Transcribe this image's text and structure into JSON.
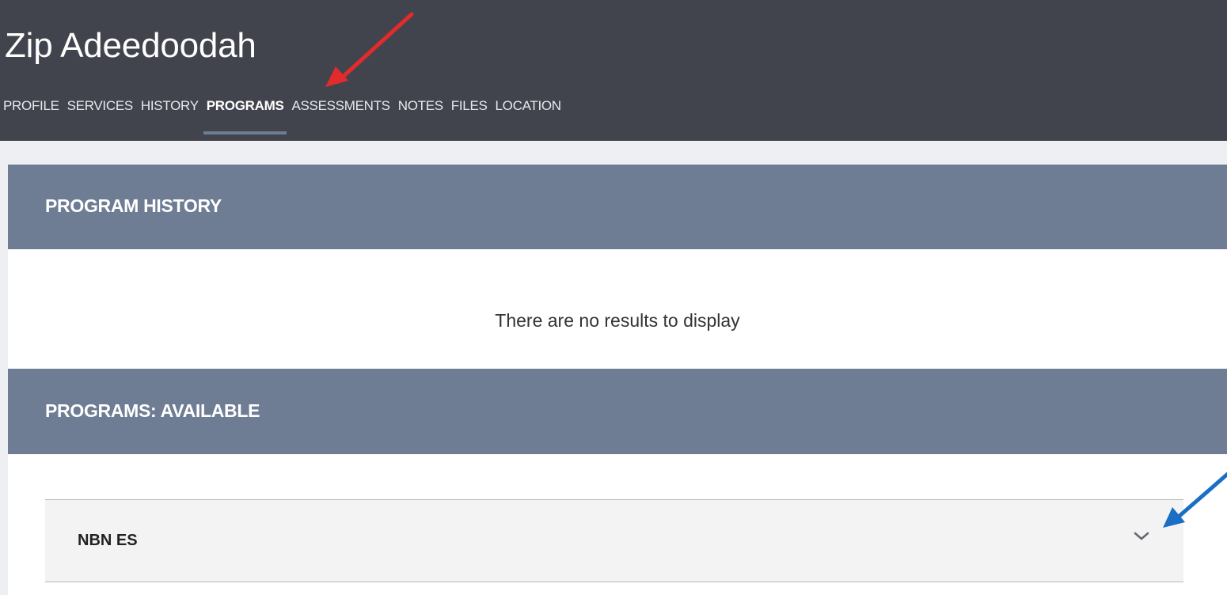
{
  "header": {
    "title": "Zip Adeedoodah",
    "tabs": [
      {
        "label": "PROFILE",
        "active": false
      },
      {
        "label": "SERVICES",
        "active": false
      },
      {
        "label": "HISTORY",
        "active": false
      },
      {
        "label": "PROGRAMS",
        "active": true
      },
      {
        "label": "ASSESSMENTS",
        "active": false
      },
      {
        "label": "NOTES",
        "active": false
      },
      {
        "label": "FILES",
        "active": false
      },
      {
        "label": "LOCATION",
        "active": false
      }
    ]
  },
  "program_history": {
    "title": "PROGRAM HISTORY",
    "empty_message": "There are no results to display"
  },
  "programs_available": {
    "title": "PROGRAMS: AVAILABLE",
    "items": [
      {
        "label": "NBN ES",
        "icon": "chevron-down-icon",
        "expanded": false
      }
    ]
  },
  "annotations": {
    "red_arrow_color": "#e32b2b",
    "blue_arrow_color": "#1a6fc4"
  },
  "colors": {
    "header_bg": "#42444d",
    "panel_header_bg": "#6e7d94",
    "page_bg": "#eeeff3",
    "active_tab_indicator": "#6d7d95"
  }
}
